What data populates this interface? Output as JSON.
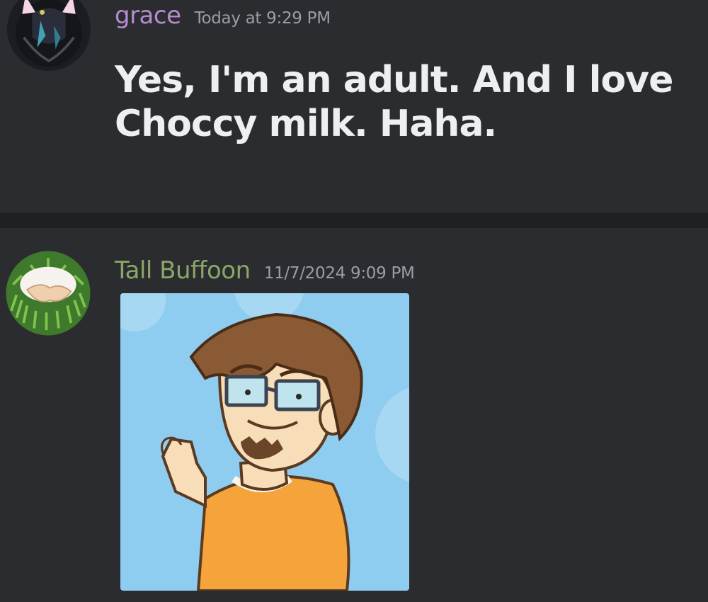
{
  "messages": [
    {
      "username": "grace",
      "timestamp": "Today at 9:29 PM",
      "content": "Yes, I'm an adult. And I love Choccy milk. Haha."
    },
    {
      "username": "Tall Buffoon",
      "timestamp": "11/7/2024 9:09 PM",
      "attachment_icon": "cartoon-man-thumbs-up-image"
    }
  ],
  "colors": {
    "background": "#2b2c30",
    "divider": "#1f2023",
    "username_grace": "#b58ccf",
    "username_tall_buffoon": "#8aa668",
    "timestamp": "#9b9da3",
    "message_text": "#eeeff1"
  }
}
